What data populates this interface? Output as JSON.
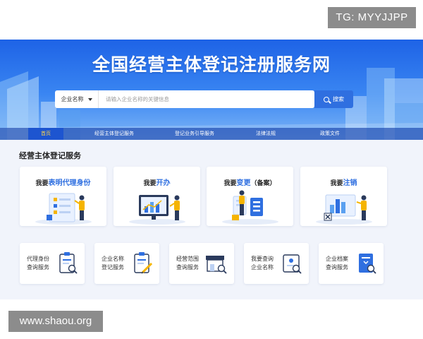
{
  "watermark_top": "TG: MYYJJPP",
  "watermark_bottom": "www.shaou.org",
  "site": {
    "title": "全国经营主体登记注册服务网"
  },
  "search": {
    "select_label": "企业名称",
    "placeholder": "请输入企业名称的关键信息",
    "button_label": "搜索"
  },
  "nav": {
    "items": [
      {
        "label": "首页"
      },
      {
        "label": "经营主体登记服务"
      },
      {
        "label": "登记业务引导服务"
      },
      {
        "label": "法律法规"
      },
      {
        "label": "政策文件"
      }
    ]
  },
  "section": {
    "title": "经营主体登记服务"
  },
  "big_cards": [
    {
      "prefix": "我要",
      "highlight": "表明代理身份",
      "suffix": ""
    },
    {
      "prefix": "我要",
      "highlight": "开办",
      "suffix": ""
    },
    {
      "prefix": "我要",
      "highlight": "变更",
      "suffix": "（备案）"
    },
    {
      "prefix": "我要",
      "highlight": "注销",
      "suffix": ""
    }
  ],
  "small_cards": [
    {
      "line1": "代理身份",
      "line2": "查询服务"
    },
    {
      "line1": "企业名称",
      "line2": "登记服务"
    },
    {
      "line1": "经营范围",
      "line2": "查询服务"
    },
    {
      "line1": "我要查询",
      "line2": "企业名称"
    },
    {
      "line1": "企业档案",
      "line2": "查询服务"
    }
  ],
  "colors": {
    "primary": "#2f6fe0",
    "banner_top": "#1e63e6",
    "nav_active_text": "#ffd54a",
    "accent_yellow": "#f5b400",
    "page_bg": "#f1f4fb"
  }
}
